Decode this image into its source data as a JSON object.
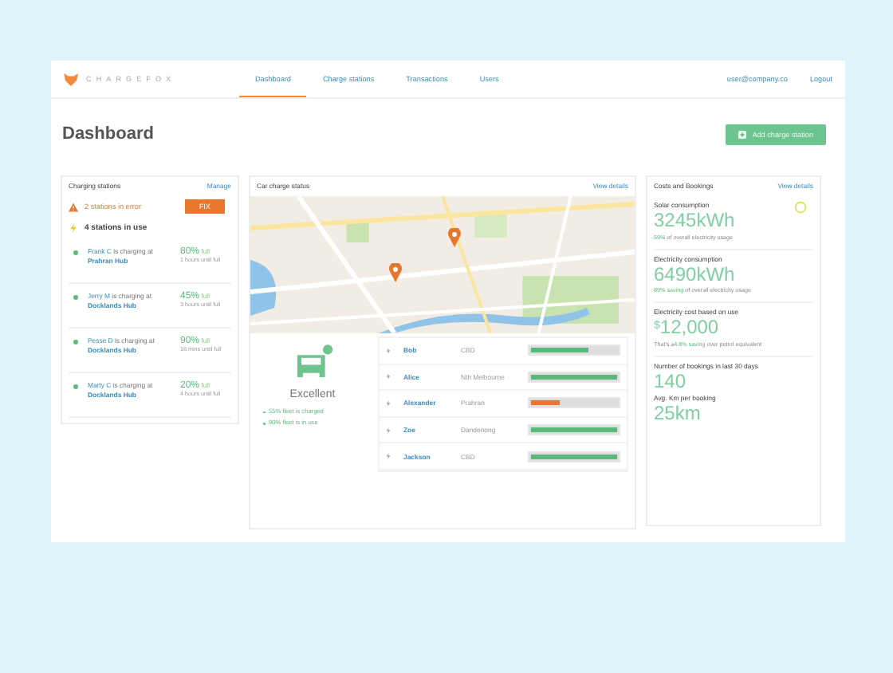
{
  "brand": "CHARGEFOX",
  "nav": [
    {
      "label": "Dashboard",
      "selected": true
    },
    {
      "label": "Charge stations",
      "selected": false
    },
    {
      "label": "Transactions",
      "selected": false
    },
    {
      "label": "Users",
      "selected": false
    }
  ],
  "user": "user@company.co",
  "logout": "Logout",
  "title": "Dashboard",
  "add_button": "Add charge station",
  "stations": {
    "title": "Charging stations",
    "manage": "Manage",
    "error_text": "2 stations in error",
    "fix": "FIX",
    "in_use_text": "4 stations in use",
    "items": [
      {
        "driver": "Frank C",
        "connector": "is charging at",
        "hub": "Prahran Hub",
        "percent": "80%",
        "full": "full",
        "eta": "1 hours until full"
      },
      {
        "driver": "Jerry M",
        "connector": "is charging at",
        "hub": "Docklands Hub",
        "percent": "45%",
        "full": "full",
        "eta": "3 hours until full"
      },
      {
        "driver": "Pesse D",
        "connector": "is charging at",
        "hub": "Docklands Hub",
        "percent": "90%",
        "full": "full",
        "eta": "16 mins until full"
      },
      {
        "driver": "Marty C",
        "connector": "is charging at",
        "hub": "Docklands Hub",
        "percent": "20%",
        "full": "full",
        "eta": "4 hours until full"
      }
    ]
  },
  "status": {
    "title": "Car charge status",
    "details": "View details",
    "rating": "Excellent",
    "facts": [
      "55% fleet is charged",
      "90% fleet is in use"
    ],
    "cars": [
      {
        "name": "Bob",
        "place": "CBD",
        "level": 0.66,
        "color": "#5bb97b"
      },
      {
        "name": "Alice",
        "place": "Nth Melbourne",
        "level": 1,
        "color": "#5bb97b"
      },
      {
        "name": "Alexander",
        "place": "Prahran",
        "level": 0.33,
        "color": "#e8772e"
      },
      {
        "name": "Zoe",
        "place": "Dandenong",
        "level": 1,
        "color": "#5bb97b"
      },
      {
        "name": "Jackson",
        "place": "CBD",
        "level": 1,
        "color": "#5bb97b"
      }
    ]
  },
  "costs": {
    "title": "Costs and Bookings",
    "details": "View details",
    "blocks": [
      {
        "label": "Solar consumption",
        "value": "3245kWh",
        "highlight": "59%",
        "note": "of overall electricity usage",
        "ring": true
      },
      {
        "label": "Electricity consumption",
        "value": "6490kWh",
        "highlight": "89% saving",
        "note": "of overall electricity usage",
        "ring": false
      },
      {
        "label": "Electricity cost based on use",
        "currency": "$",
        "value": "12,000",
        "lead": "That's a",
        "highlight": "4.8% saving",
        "note": "over petrol equivalent",
        "ring": false
      }
    ],
    "bookings": [
      {
        "label": "Number of bookings in last 30 days",
        "value": "140"
      },
      {
        "label": "Avg. Km per booking",
        "value": "25km"
      }
    ]
  }
}
